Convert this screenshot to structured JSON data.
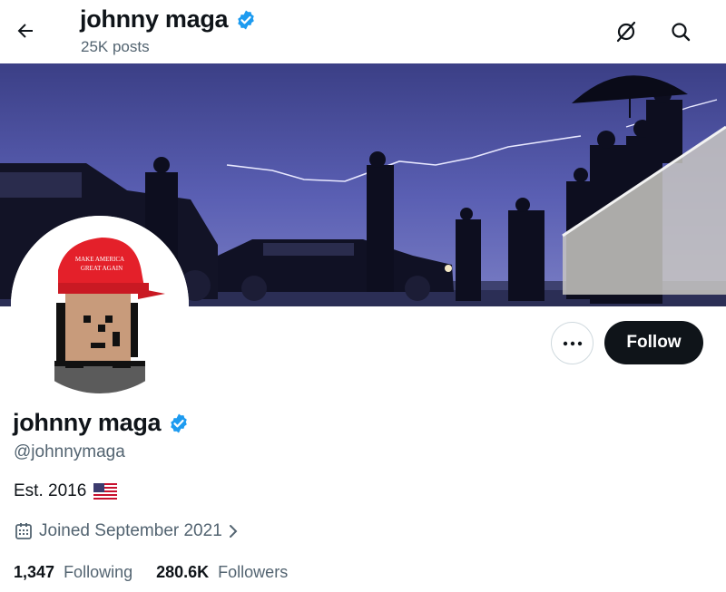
{
  "header": {
    "name": "johnny maga",
    "posts": "25K posts"
  },
  "actions": {
    "follow_label": "Follow",
    "more_label": "•••"
  },
  "profile": {
    "name": "johnny maga",
    "handle": "@johnnymaga",
    "bio": "Est. 2016",
    "joined": "Joined September 2021",
    "following_count": "1,347",
    "following_label": "Following",
    "followers_count": "280.6K",
    "followers_label": "Followers"
  },
  "avatar_hat_text": [
    "MAKE AMERICA",
    "GREAT AGAIN"
  ],
  "icons": {
    "back": "arrow-left-icon",
    "verified": "verified-badge-icon",
    "grok": "grok-icon",
    "search": "search-icon",
    "flag": "us-flag-icon",
    "calendar": "calendar-icon",
    "chevron": "chevron-right-icon"
  },
  "colors": {
    "verified": "#1d9bf0",
    "follow_bg": "#0f1419",
    "secondary_text": "#536471"
  }
}
